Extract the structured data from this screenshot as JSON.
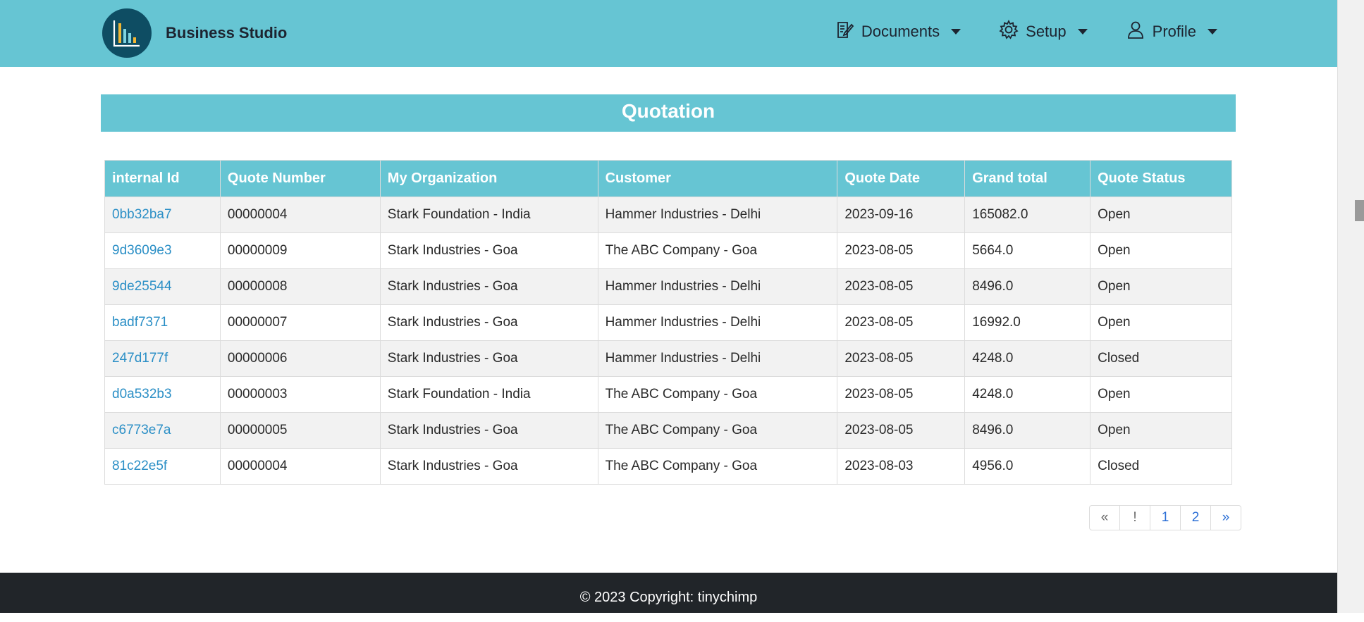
{
  "app": {
    "name": "Business Studio",
    "logo_icon": "bar-chart-logo-icon"
  },
  "nav": {
    "items": [
      {
        "label": "Documents",
        "icon": "document-edit-icon"
      },
      {
        "label": "Setup",
        "icon": "gear-icon"
      },
      {
        "label": "Profile",
        "icon": "user-icon"
      }
    ]
  },
  "page": {
    "title": "Quotation"
  },
  "table": {
    "headers": [
      "internal Id",
      "Quote Number",
      "My Organization",
      "Customer",
      "Quote Date",
      "Grand total",
      "Quote Status"
    ],
    "rows": [
      [
        "0bb32ba7",
        "00000004",
        "Stark Foundation - India",
        "Hammer Industries - Delhi",
        "2023-09-16",
        "165082.0",
        "Open"
      ],
      [
        "9d3609e3",
        "00000009",
        "Stark Industries - Goa",
        "The ABC Company - Goa",
        "2023-08-05",
        "5664.0",
        "Open"
      ],
      [
        "9de25544",
        "00000008",
        "Stark Industries - Goa",
        "Hammer Industries - Delhi",
        "2023-08-05",
        "8496.0",
        "Open"
      ],
      [
        "badf7371",
        "00000007",
        "Stark Industries - Goa",
        "Hammer Industries - Delhi",
        "2023-08-05",
        "16992.0",
        "Open"
      ],
      [
        "247d177f",
        "00000006",
        "Stark Industries - Goa",
        "Hammer Industries - Delhi",
        "2023-08-05",
        "4248.0",
        "Closed"
      ],
      [
        "d0a532b3",
        "00000003",
        "Stark Foundation - India",
        "The ABC Company - Goa",
        "2023-08-05",
        "4248.0",
        "Open"
      ],
      [
        "c6773e7a",
        "00000005",
        "Stark Industries - Goa",
        "The ABC Company - Goa",
        "2023-08-05",
        "8496.0",
        "Open"
      ],
      [
        "81c22e5f",
        "00000004",
        "Stark Industries - Goa",
        "The ABC Company - Goa",
        "2023-08-03",
        "4956.0",
        "Closed"
      ]
    ]
  },
  "pagination": {
    "items": [
      "«",
      "!",
      "1",
      "2",
      "»"
    ]
  },
  "footer": {
    "text": "© 2023 Copyright: tinychimp"
  },
  "colors": {
    "accent": "#66c5d3",
    "logo_bg": "#0e4d63",
    "link": "#2b8fc6",
    "footer_bg": "#212529"
  }
}
